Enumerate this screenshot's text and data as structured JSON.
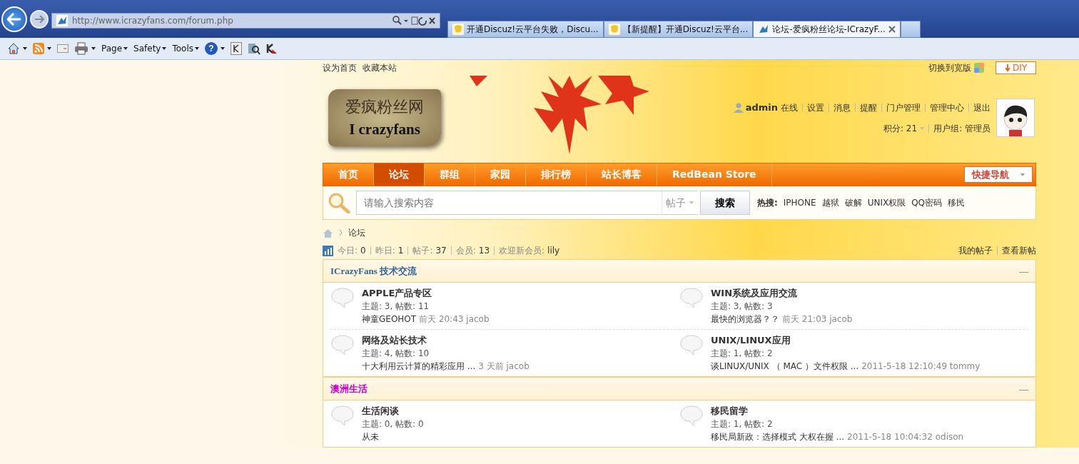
{
  "browser": {
    "address": "http://www.icrazyfans.com/forum.php",
    "tabs": [
      {
        "title": "开通Discuz!云平台失败，Discu...",
        "selected": false
      },
      {
        "title": "【新提醒】开通Discuz!云平台...",
        "selected": false
      },
      {
        "title": "论坛-爱疯粉丝论坛-ICrazyF...",
        "selected": true
      }
    ],
    "menus": [
      "Page",
      "Safety",
      "Tools"
    ],
    "help": "?"
  },
  "topbar": {
    "links": [
      "设为首页",
      "收藏本站"
    ],
    "switch": "切换到宽版",
    "diy": "DIY"
  },
  "logo": {
    "line_1": "爱疯粉丝网",
    "line_2": "I crazyfans"
  },
  "user": {
    "name": "admin",
    "status": "在线",
    "links": [
      "设置",
      "消息",
      "提醒",
      "门户管理",
      "管理中心",
      "退出"
    ],
    "points": "积分: 21",
    "group": "用户组: 管理员"
  },
  "nav": {
    "items": [
      {
        "label": "首页",
        "selected": false
      },
      {
        "label": "论坛",
        "selected": true
      },
      {
        "label": "群组",
        "selected": false
      },
      {
        "label": "家园",
        "selected": false
      },
      {
        "label": "排行榜",
        "selected": false
      },
      {
        "label": "站长博客",
        "selected": false
      },
      {
        "label": "RedBean Store",
        "selected": false
      }
    ],
    "quick": "快捷导航"
  },
  "search": {
    "placeholder": "请输入搜索内容",
    "type": "帖子",
    "button": "搜索",
    "hot_label": "热搜:",
    "hot": [
      "IPHONE",
      "越狱",
      "破解",
      "UNIX权限",
      "QQ密码",
      "移民"
    ]
  },
  "breadcrumb": "论坛",
  "stats": [
    {
      "label": "今日:",
      "value": "0"
    },
    {
      "label": "昨日:",
      "value": "1"
    },
    {
      "label": "帖子:",
      "value": "37"
    },
    {
      "label": "会员:",
      "value": "13"
    },
    {
      "label": "欢迎新会员:",
      "value": "lily"
    }
  ],
  "stats_links": [
    "我的帖子",
    "查看新帖"
  ],
  "categories": [
    {
      "name": "ICrazyFans 技术交流",
      "color": "#336699",
      "collapse": "—",
      "forums": [
        {
          "name": "APPLE产品专区",
          "stats": "主题: 3, 帖数: 11",
          "last_title": "神童GEOHOT",
          "last_info": "前天 20:43 jacob"
        },
        {
          "name": "WIN系统及应用交流",
          "stats": "主题: 3, 帖数: 3",
          "last_title": "最快的浏览器？？",
          "last_info": "前天 21:03 jacob"
        },
        {
          "name": "网络及站长技术",
          "stats": "主题: 4, 帖数: 10",
          "last_title": "十大利用云计算的精彩应用 ...",
          "last_info": "3 天前 jacob"
        },
        {
          "name": "UNIX/LINUX应用",
          "stats": "主题: 1, 帖数: 2",
          "last_title": "谈LINUX/UNIX （ MAC ）文件权限 ...",
          "last_info": "2011-5-18 12:10:49 tommy"
        }
      ]
    },
    {
      "name": "澳洲生活",
      "color": "#cc00cc",
      "collapse": "—",
      "forums": [
        {
          "name": "生活闲谈",
          "stats": "主题: 0, 帖数: 0",
          "last_title": "从未"
        },
        {
          "name": "移民留学",
          "stats": "主题: 1, 帖数: 2",
          "last_title": "移民局新政：选择模式 大权在握 ...",
          "last_info": "2011-5-18 10:04:32 odison"
        }
      ]
    }
  ]
}
